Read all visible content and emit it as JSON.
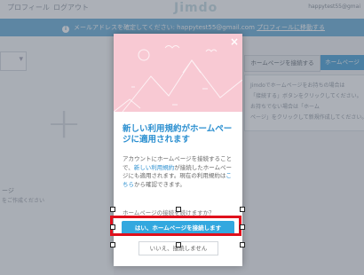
{
  "topbar": {
    "nav_profile": "プロフィール",
    "nav_logout": "ログアウト",
    "logo": "Jimdo",
    "email": "happytest55@gmai"
  },
  "notice": {
    "text": "メールアドレスを確定してください: happytest55@gmail.com",
    "link": "プロフィールに移動する"
  },
  "background": {
    "plus": "+",
    "left_text_1": "ージ",
    "left_text_2": "をご作成ください",
    "btn_connect": "ホームページを接続する",
    "btn_create": "ホームページ",
    "right_lines": [
      "Jimdoでホームページをお持ちの場合は",
      "「接続する」ボタンをクリックしてください。",
      "お持ちでない場合は「ホーム",
      "ページ」をクリックして新規作成してください。"
    ]
  },
  "modal": {
    "close": "×",
    "heading": "新しい利用規約がホームページに適用されます",
    "body_1": "アカウントにホームページを接続することで、",
    "body_link_1": "新しい利用規約",
    "body_2": "が接続したホームページにも適用されます。現在の利用規約は",
    "body_link_2": "こちら",
    "body_3": "から確認できます。",
    "question": "ホームページの接続を続けますか？",
    "primary_button": "はい、ホームページを接続します",
    "secondary_button": "いいえ、接続しません"
  },
  "colors": {
    "accent": "#33a8df",
    "notice_bg": "#6fb2db",
    "header_pink": "#f8c9d3",
    "highlight_red": "#e0101c"
  }
}
